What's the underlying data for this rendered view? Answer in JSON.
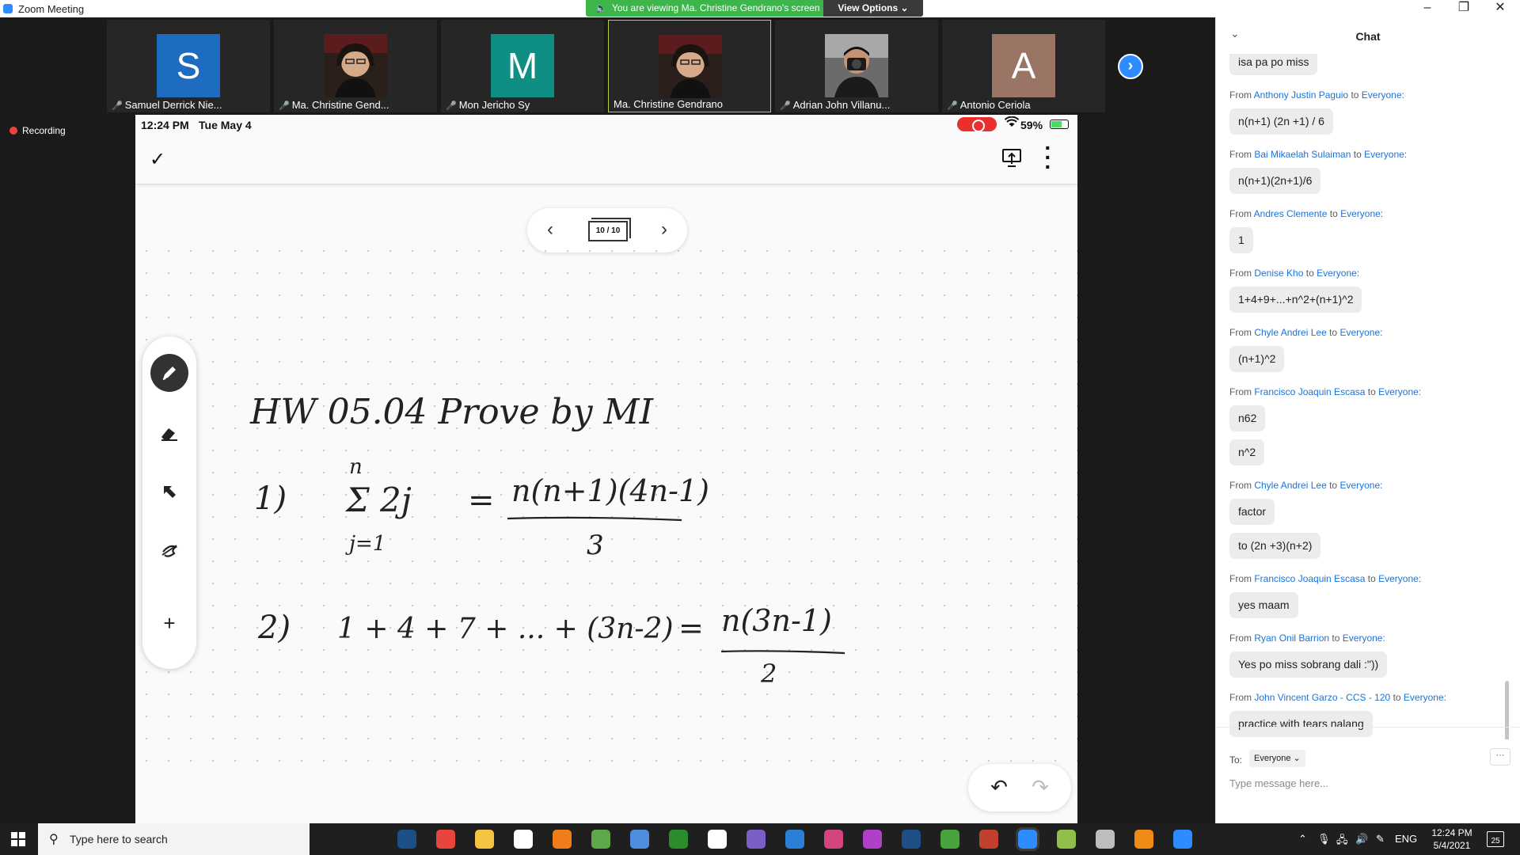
{
  "window": {
    "title": "Zoom Meeting",
    "viewing_banner": "You are viewing Ma. Christine Gendrano's screen",
    "view_options": "View Options"
  },
  "gallery": {
    "participants": [
      {
        "name": "Samuel Derrick Nie...",
        "initial": "S",
        "color": "#1e6cc0",
        "muted": true
      },
      {
        "name": "Ma. Christine Gend...",
        "initial": "",
        "color": "#3a2a22",
        "muted": true
      },
      {
        "name": "Mon Jericho Sy",
        "initial": "M",
        "color": "#0f8f84",
        "muted": true
      },
      {
        "name": "Ma. Christine Gendrano",
        "initial": "",
        "color": "#3a2a22",
        "muted": false
      },
      {
        "name": "Adrian John Villanu...",
        "initial": "",
        "color": "#3b3b3b",
        "muted": true
      },
      {
        "name": "Antonio Ceriola",
        "initial": "A",
        "color": "#9a7565",
        "muted": true
      }
    ],
    "active_speaker_index": 3
  },
  "recording": {
    "label": "Recording"
  },
  "ipad": {
    "time": "12:24 PM",
    "date": "Tue May 4",
    "battery_pct": "59%",
    "battery_level": 0.59,
    "page_counter": "10 / 10"
  },
  "notes": {
    "line1": "HW 05.04    Prove by MI",
    "eq1_label": "1)",
    "eq1_lhs": "Σ 2j",
    "eq1_top": "n",
    "eq1_bottom": "j=1",
    "eq1_num": "n(n+1)(4n-1)",
    "eq1_den": "3",
    "eq2_label": "2)",
    "eq2_lhs": "1 + 4 + 7 + ... + (3n-2)",
    "eq2_num": "n(3n-1)",
    "eq2_den": "2"
  },
  "chat": {
    "title": "Chat",
    "top_bubble": "isa pa po miss",
    "from_word": "From",
    "to_word": "to",
    "messages": [
      {
        "from": "Anthony Justin Paguio",
        "to": "Everyone:",
        "texts": [
          "n(n+1) (2n +1) / 6"
        ]
      },
      {
        "from": "Bai Mikaelah Sulaiman",
        "to": "Everyone:",
        "texts": [
          "n(n+1)(2n+1)/6"
        ]
      },
      {
        "from": "Andres Clemente",
        "to": "Everyone:",
        "texts": [
          "1"
        ]
      },
      {
        "from": "Denise Kho",
        "to": "Everyone:",
        "texts": [
          "1+4+9+...+n^2+(n+1)^2"
        ]
      },
      {
        "from": "Chyle Andrei Lee",
        "to": "Everyone:",
        "texts": [
          "(n+1)^2"
        ]
      },
      {
        "from": "Francisco Joaquin Escasa",
        "to": "Everyone:",
        "texts": [
          "n62",
          "n^2"
        ]
      },
      {
        "from": "Chyle Andrei Lee",
        "to": "Everyone:",
        "texts": [
          "factor",
          "to (2n +3)(n+2)"
        ]
      },
      {
        "from": "Francisco Joaquin Escasa",
        "to": "Everyone:",
        "texts": [
          "yes maam"
        ]
      },
      {
        "from": "Ryan Onil Barrion",
        "to": "Everyone:",
        "texts": [
          "Yes po miss sobrang dali :\"))"
        ]
      },
      {
        "from": "John Vincent Garzo - CCS - 120",
        "to": "Everyone:",
        "texts": [
          "practice with tears nalang"
        ]
      }
    ],
    "to_label": "To:",
    "to_value": "Everyone",
    "more_label": "···",
    "input_placeholder": "Type message here..."
  },
  "taskbar": {
    "search_placeholder": "Type here to search",
    "language": "ENG",
    "time": "12:24 PM",
    "date": "5/4/2021",
    "notification_count": "25",
    "icons": [
      {
        "name": "cortana-icon",
        "color": "#1f1f1f"
      },
      {
        "name": "task-view-icon",
        "color": "#1f1f1f"
      },
      {
        "name": "steam-icon",
        "color": "#1b4f86"
      },
      {
        "name": "chrome-icon",
        "color": "#e8453c"
      },
      {
        "name": "file-explorer-icon",
        "color": "#f4c542"
      },
      {
        "name": "notes-icon",
        "color": "#ffffff"
      },
      {
        "name": "microphone-app-icon",
        "color": "#ef7d1a"
      },
      {
        "name": "game-icon",
        "color": "#5fa84a"
      },
      {
        "name": "compass-icon",
        "color": "#4e8de0"
      },
      {
        "name": "xbox-icon",
        "color": "#2b8c2b"
      },
      {
        "name": "phone-link-icon",
        "color": "#ffffff"
      },
      {
        "name": "visual-studio-icon",
        "color": "#7b5fc7"
      },
      {
        "name": "mail-app-icon",
        "color": "#2c7fd6"
      },
      {
        "name": "messenger-badge-icon",
        "color": "#d4447e"
      },
      {
        "name": "messenger-icon",
        "color": "#b040c8"
      },
      {
        "name": "steam-alt-icon",
        "color": "#1b4f86"
      },
      {
        "name": "utorrent-icon",
        "color": "#49a33d"
      },
      {
        "name": "winrar-icon",
        "color": "#c2402e"
      },
      {
        "name": "zoom-icon",
        "color": "#2d8cff"
      },
      {
        "name": "snipping-icon",
        "color": "#8fbf4a"
      },
      {
        "name": "media-player-icon",
        "color": "#bdbdbd"
      },
      {
        "name": "vlc-icon",
        "color": "#ef8a14"
      },
      {
        "name": "settings-app-icon",
        "color": "#2d8cff"
      }
    ]
  }
}
